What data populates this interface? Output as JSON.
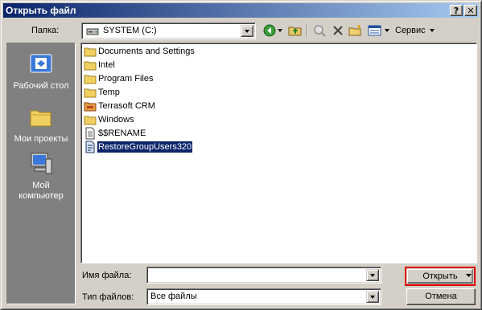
{
  "window": {
    "title": "Открыть файл",
    "help_glyph": "?",
    "close_glyph": "✕"
  },
  "toolbar": {
    "folder_label": "Папка:",
    "folder_value": "SYSTEM (C:)",
    "service_label": "Сервис"
  },
  "places": [
    {
      "label": "Рабочий стол",
      "icon": "desktop-icon"
    },
    {
      "label": "Мои проекты",
      "icon": "folder-icon"
    },
    {
      "label": "Мой компьютер",
      "icon": "computer-icon"
    }
  ],
  "files": [
    {
      "name": "Documents and Settings",
      "icon": "folder-icon"
    },
    {
      "name": "Intel",
      "icon": "folder-icon"
    },
    {
      "name": "Program Files",
      "icon": "folder-icon"
    },
    {
      "name": "Temp",
      "icon": "folder-icon"
    },
    {
      "name": "Terrasoft CRM",
      "icon": "folder-icon"
    },
    {
      "name": "Windows",
      "icon": "folder-icon"
    },
    {
      "name": "$$RENAME",
      "icon": "text-file-icon"
    },
    {
      "name": "RestoreGroupUsers320",
      "icon": "script-file-icon",
      "selected": true
    }
  ],
  "bottom": {
    "filename_label": "Имя файла:",
    "filename_value": "",
    "filetype_label": "Тип файлов:",
    "filetype_value": "Все файлы",
    "open_label": "Открыть",
    "cancel_label": "Отмена"
  },
  "colors": {
    "highlight_border": "#e00000",
    "selection_bg": "#0a246a",
    "title_bar": "#0a246a"
  }
}
